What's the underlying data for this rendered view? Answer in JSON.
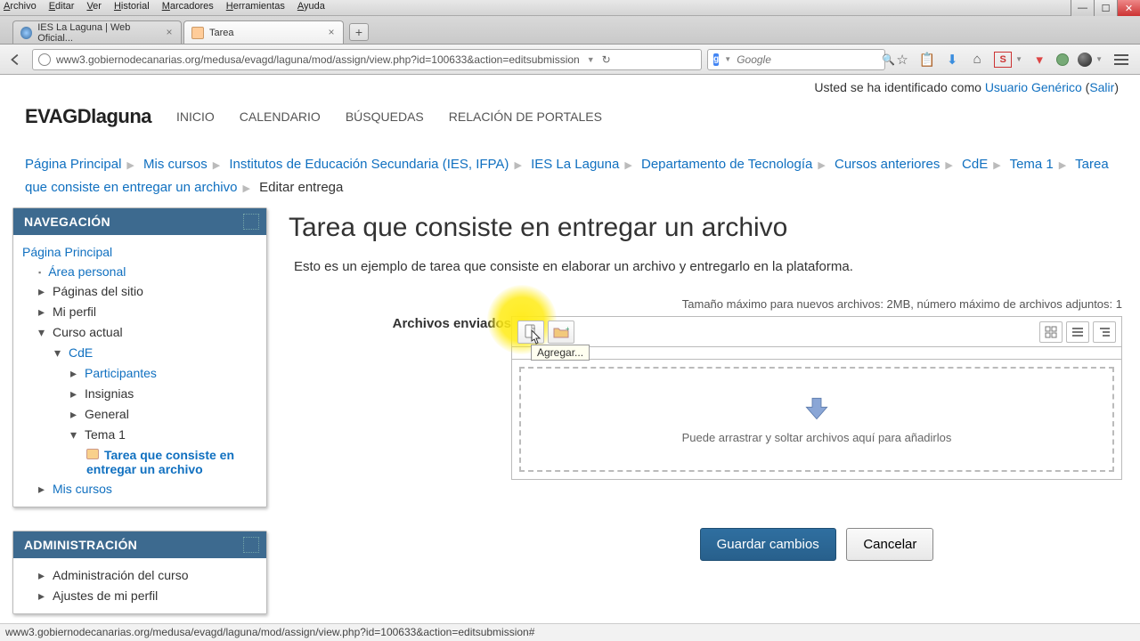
{
  "os_menus": [
    "Archivo",
    "Editar",
    "Ver",
    "Historial",
    "Marcadores",
    "Herramientas",
    "Ayuda"
  ],
  "tabs": [
    {
      "title": "IES La Laguna | Web Oficial...",
      "active": false
    },
    {
      "title": "Tarea",
      "active": true
    }
  ],
  "url": "www3.gobiernodecanarias.org/medusa/evagd/laguna/mod/assign/view.php?id=100633&action=editsubmission",
  "search_placeholder": "Google",
  "login": {
    "prefix": "Usted se ha identificado como ",
    "user": "Usuario Genérico",
    "logout": "Salir"
  },
  "brand": "EVAGDlaguna",
  "topnav": [
    "INICIO",
    "CALENDARIO",
    "BÚSQUEDAS",
    "RELACIÓN DE PORTALES"
  ],
  "breadcrumbs": [
    "Página Principal",
    "Mis cursos",
    "Institutos de Educación Secundaria (IES, IFPA)",
    "IES La Laguna",
    "Departamento de Tecnología",
    "Cursos anteriores",
    "CdE",
    "Tema 1",
    "Tarea que consiste en entregar un archivo"
  ],
  "breadcrumb_current": "Editar entrega",
  "nav_block": {
    "title": "NAVEGACIÓN",
    "root": "Página Principal",
    "items": [
      {
        "label": "Área personal",
        "cls": "lvl2 bullet",
        "link": true
      },
      {
        "label": "Páginas del sitio",
        "cls": "lvl2 arrow"
      },
      {
        "label": "Mi perfil",
        "cls": "lvl2 arrow"
      },
      {
        "label": "Curso actual",
        "cls": "lvl2 arrowd"
      },
      {
        "label": "CdE",
        "cls": "lvl3 arrowd",
        "link": true
      },
      {
        "label": "Participantes",
        "cls": "lvl4 arrow",
        "link": true
      },
      {
        "label": "Insignias",
        "cls": "lvl4 arrow"
      },
      {
        "label": "General",
        "cls": "lvl4 arrow"
      },
      {
        "label": "Tema 1",
        "cls": "lvl4 arrowd"
      },
      {
        "label": "Tarea que consiste en entregar un archivo",
        "cls": "lvl5 current",
        "task": true,
        "link": true
      },
      {
        "label": "Mis cursos",
        "cls": "lvl2 arrow",
        "link": true
      }
    ]
  },
  "admin_block": {
    "title": "ADMINISTRACIÓN",
    "items": [
      {
        "label": "Administración del curso",
        "cls": "lvl2 arrow"
      },
      {
        "label": "Ajustes de mi perfil",
        "cls": "lvl2 arrow"
      }
    ]
  },
  "page_title": "Tarea que consiste en entregar un archivo",
  "page_desc": "Esto es un ejemplo de tarea que consiste en elaborar un archivo y entregarlo en la plataforma.",
  "form": {
    "files_label": "Archivos enviados",
    "max_info": "Tamaño máximo para nuevos archivos: 2MB, número máximo de archivos adjuntos: 1",
    "add_tooltip": "Agregar...",
    "dropzone_text": "Puede arrastrar y soltar archivos aquí para añadirlos",
    "save": "Guardar cambios",
    "cancel": "Cancelar"
  },
  "status_url": "www3.gobiernodecanarias.org/medusa/evagd/laguna/mod/assign/view.php?id=100633&action=editsubmission#"
}
